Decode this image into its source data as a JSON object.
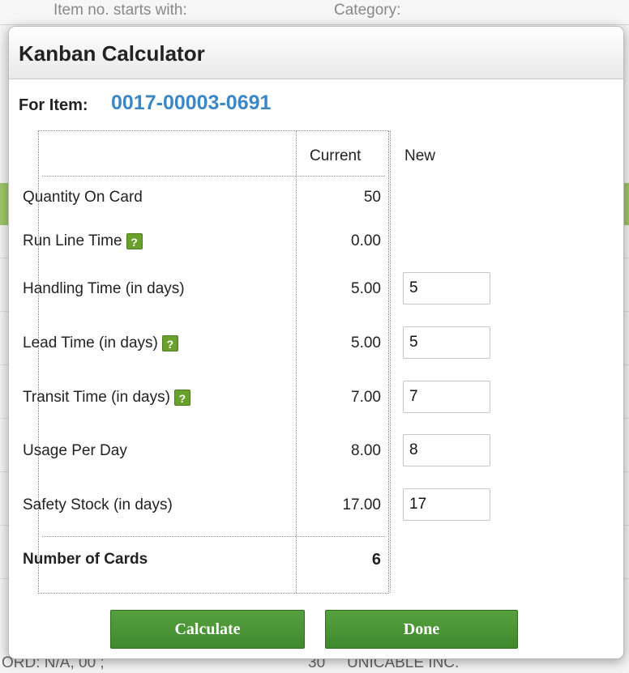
{
  "background": {
    "filter_item_no_label": "Item no. starts with:",
    "filter_category_label": "Category:",
    "footer_left_text": "ORD: N/A, 00 ;",
    "footer_qty_text": "30",
    "footer_vendor_text": "UNICABLE INC."
  },
  "modal": {
    "title": "Kanban Calculator",
    "for_item_label": "For Item:",
    "item_number": "0017-00003-0691"
  },
  "table": {
    "col_current": "Current",
    "col_new": "New",
    "rows": [
      {
        "label": "Quantity On Card",
        "current": "50",
        "help": false
      },
      {
        "label": "Run Line Time",
        "current": "0.00",
        "help": true
      },
      {
        "label": "Handling Time (in days)",
        "current": "5.00",
        "new": "5",
        "help": false
      },
      {
        "label": "Lead Time (in days)",
        "current": "5.00",
        "new": "5",
        "help": true
      },
      {
        "label": "Transit Time (in days)",
        "current": "7.00",
        "new": "7",
        "help": true
      },
      {
        "label": "Usage Per Day",
        "current": "8.00",
        "new": "8",
        "help": false
      },
      {
        "label": "Safety Stock (in days)",
        "current": "17.00",
        "new": "17",
        "help": false
      }
    ],
    "total": {
      "label": "Number of Cards",
      "current": "6"
    }
  },
  "icons": {
    "help_glyph": "?"
  },
  "buttons": {
    "calculate": "Calculate",
    "done": "Done"
  },
  "colors": {
    "item_number": "#3b87c6",
    "button_green": "#4a9636",
    "help_icon_green": "#6aa02c"
  }
}
